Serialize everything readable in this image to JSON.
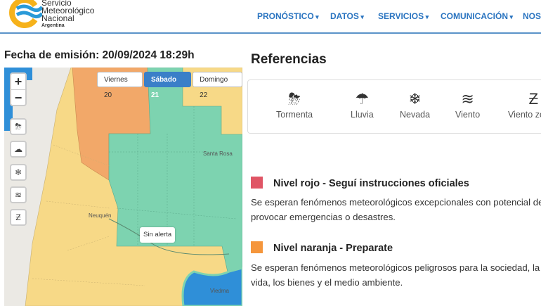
{
  "header": {
    "brand": [
      "Servicio",
      "Meteorológico",
      "Nacional"
    ],
    "country": "Argentina",
    "nav": [
      "PRONÓSTICO",
      "DATOS",
      "SERVICIOS",
      "COMUNICACIÓN",
      "NOS"
    ]
  },
  "fecha": "Fecha de emisión: 20/09/2024 18:29h",
  "map": {
    "zoom_in": "+",
    "zoom_out": "−",
    "days": [
      "Viernes 20",
      "Sábado 21",
      "Domingo 22"
    ],
    "selected_day": "Sábado 21",
    "tooltip": "Sin alerta",
    "cities": [
      "Santa Rosa",
      "Neuquén",
      "Viedma"
    ],
    "colors": {
      "amarillo": "#f7d987",
      "naranja": "#f2a869",
      "sin_alerta": "#7dd3b0",
      "mar": "#2f8fd8"
    }
  },
  "referencias": {
    "title": "Referencias",
    "items": [
      {
        "label": "Tormenta",
        "icon": "storm-icon"
      },
      {
        "label": "Lluvia",
        "icon": "rain-icon"
      },
      {
        "label": "Nevada",
        "icon": "snow-icon"
      },
      {
        "label": "Viento",
        "icon": "wind-icon"
      },
      {
        "label": "Viento zonda",
        "icon": "zonda-icon"
      }
    ]
  },
  "niveles": [
    {
      "title": "Nivel rojo - Seguí instrucciones oficiales",
      "color": "#e05565",
      "text": [
        "Se esperan fenómenos meteorológicos excepcionales con potencial de",
        "provocar emergencias o desastres."
      ]
    },
    {
      "title": "Nivel naranja - Preparate",
      "color": "#f5963c",
      "text": [
        "Se esperan fenómenos meteorológicos peligrosos para la sociedad, la",
        "vida, los bienes y el medio ambiente."
      ]
    }
  ]
}
